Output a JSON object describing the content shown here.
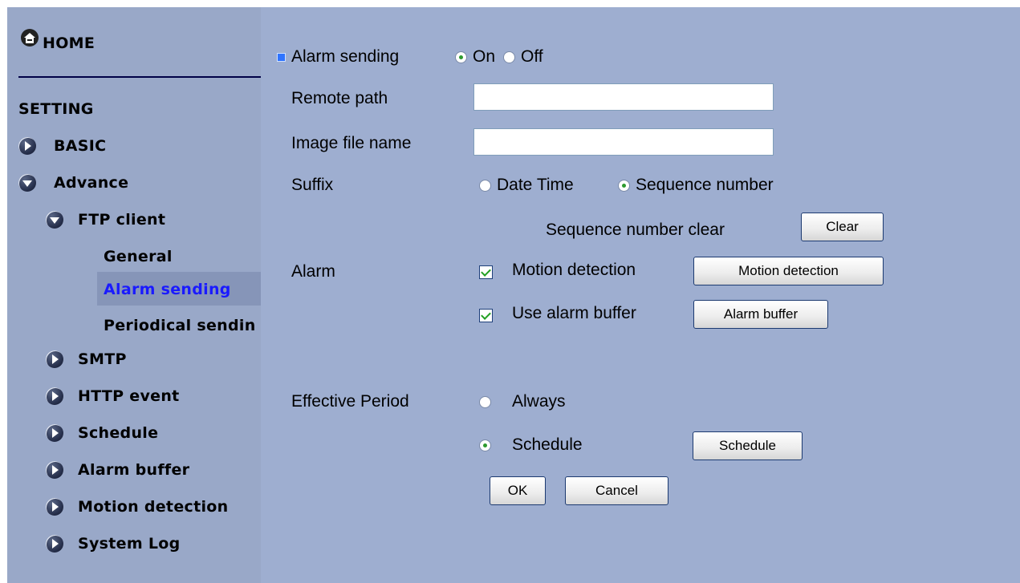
{
  "sidebar": {
    "home_label": "HOME",
    "setting_label": "SETTING",
    "items": [
      {
        "label": "BASIC",
        "icon": "arrow-right-icon"
      },
      {
        "label": "Advance",
        "icon": "arrow-down-icon"
      },
      {
        "label": "FTP client",
        "icon": "arrow-down-icon"
      },
      {
        "label": "General"
      },
      {
        "label": "Alarm sending",
        "selected": true
      },
      {
        "label": "Periodical sendin"
      },
      {
        "label": "SMTP",
        "icon": "arrow-right-icon"
      },
      {
        "label": "HTTP event",
        "icon": "arrow-right-icon"
      },
      {
        "label": "Schedule",
        "icon": "arrow-right-icon"
      },
      {
        "label": "Alarm buffer",
        "icon": "arrow-right-icon"
      },
      {
        "label": "Motion detection",
        "icon": "arrow-right-icon"
      },
      {
        "label": "System Log",
        "icon": "arrow-right-icon"
      }
    ]
  },
  "form": {
    "alarm_sending": {
      "label": "Alarm sending",
      "on_label": "On",
      "off_label": "Off",
      "value": "On"
    },
    "remote_path": {
      "label": "Remote path",
      "value": ""
    },
    "image_file_name": {
      "label": "Image file name",
      "value": ""
    },
    "suffix": {
      "label": "Suffix",
      "option_datetime": "Date Time",
      "option_sequence": "Sequence number",
      "value": "Sequence number"
    },
    "sequence_clear": {
      "label": "Sequence number clear",
      "button": "Clear"
    },
    "alarm": {
      "label": "Alarm",
      "motion_label": "Motion detection",
      "motion_checked": true,
      "motion_button": "Motion detection",
      "buffer_label": "Use alarm buffer",
      "buffer_checked": true,
      "buffer_button": "Alarm buffer"
    },
    "effective_period": {
      "label": "Effective Period",
      "option_always": "Always",
      "option_schedule": "Schedule",
      "value": "Schedule",
      "schedule_button": "Schedule"
    },
    "ok_button": "OK",
    "cancel_button": "Cancel"
  },
  "colors": {
    "background": "#9eaed0",
    "sidebar": "#99a8c8",
    "selected_item_bg": "#8695b8",
    "selected_item_text": "#1a1aff"
  }
}
